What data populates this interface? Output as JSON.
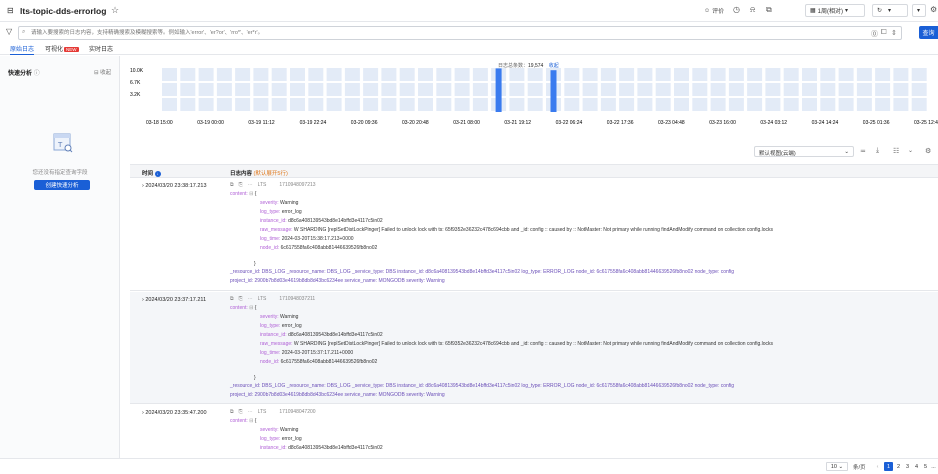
{
  "header": {
    "title": "lts-topic-dds-errorlog",
    "eval_label": "评价",
    "time_range": "1周(相对)",
    "colors": {
      "accent": "#1a5fd6"
    }
  },
  "search": {
    "placeholder": "请输入要搜索的日志内容，支持精确搜索及模糊搜索等。例如输入'error'、'er?or'、'rro*'、'er*r'。",
    "button_label": "查询"
  },
  "tabs": [
    {
      "label": "原始日志",
      "active": true
    },
    {
      "label": "可视化",
      "badge": "NEW"
    },
    {
      "label": "实时日志"
    }
  ],
  "sidebar": {
    "title": "快速分析",
    "fold_label": "收起",
    "empty_text": "您还没有指定查询字段",
    "create_button": "创建快速分析"
  },
  "chart_data": {
    "type": "bar",
    "total_label": "日志总条数：",
    "total_value": "19,574",
    "fold_label": "收起",
    "y_ticks": [
      "10.0K",
      "6.7K",
      "3.2K"
    ],
    "x_labels": [
      "03-18 15:00",
      "03-19 00:00",
      "03-19 11:12",
      "03-19 22:24",
      "03-20 09:36",
      "03-20 20:48",
      "03-21 08:00",
      "03-21 19:12",
      "03-22 06:24",
      "03-22 17:36",
      "03-23 04:48",
      "03-23 16:00",
      "03-24 03:12",
      "03-24 14:24",
      "03-25 01:36",
      "03-25 12:48"
    ],
    "ylim": [
      0,
      10000
    ],
    "bar_count": 42,
    "highlight_bars": [
      {
        "index": 18,
        "value": 9900
      },
      {
        "index": 21,
        "value": 9500
      }
    ],
    "bar_colors": {
      "normal": "#e3ebf7",
      "highlight": "#3a7bef"
    }
  },
  "toolbar": {
    "view_select": "默认视图(云端)"
  },
  "table": {
    "col_time": "时间",
    "col_content": "日志内容",
    "col_content_hint": "(默认展开5行)",
    "rows": [
      {
        "time": "2024/03/20 23:38:17.213",
        "source": "LTS",
        "ts": "1710948097213",
        "content_label": "content:",
        "fields": [
          {
            "k": "severity:",
            "v": "Warning"
          },
          {
            "k": "log_type:",
            "v": "error_log"
          },
          {
            "k": "instance_id:",
            "v": "d8c6a408139543bd8e14bffd3e4117c5in02"
          },
          {
            "k": "raw_message:",
            "v": "W SHARDING [replSetDistLockPinger] Failed to unlock lock with ts: 65f9352e36232c478c694cbb and _id: config :: caused by :: NotMaster: Not primary while running findAndModify command on collection config.locks"
          },
          {
            "k": "log_time:",
            "v": "2024-03-20T15:38:17.213+0000"
          },
          {
            "k": "node_id:",
            "v": "6c617558fa6c408abb81446639526fb8no02"
          }
        ],
        "meta1": "_resource_id: DBS_LOG  _resource_name: DBS_LOG  _service_type: DBS  instance_id: d8c6a408139543bd8e14bffd3e4117c5in02  log_type: ERROR_LOG  node_id: 6c617558fa6c408abb81446639526fb8no02  node_type: config",
        "meta2": "project_id: 2900b7b8d03e4619b8db8d43bc6234ee  service_name: MONGODB  severity: Warning"
      },
      {
        "time": "2024/03/20 23:37:17.211",
        "source": "LTS",
        "ts": "1710948037211",
        "content_label": "content:",
        "fields": [
          {
            "k": "severity:",
            "v": "Warning"
          },
          {
            "k": "log_type:",
            "v": "error_log"
          },
          {
            "k": "instance_id:",
            "v": "d8c6a408139543bd8e14bffd3e4117c5in02"
          },
          {
            "k": "raw_message:",
            "v": "W SHARDING [replSetDistLockPinger] Failed to unlock lock with ts: 65f9352e36232c478c694cbb and _id: config :: caused by :: NotMaster: Not primary while running findAndModify command on collection config.locks"
          },
          {
            "k": "log_time:",
            "v": "2024-03-20T15:37:17.211+0000"
          },
          {
            "k": "node_id:",
            "v": "6c617558fa6c408abb81446639526fb8no02"
          }
        ],
        "meta1": "_resource_id: DBS_LOG  _resource_name: DBS_LOG  _service_type: DBS  instance_id: d8c6a408139543bd8e14bffd3e4117c5in02  log_type: ERROR_LOG  node_id: 6c617558fa6c408abb81446639526fb8no02  node_type: config",
        "meta2": "project_id: 2900b7b8d03e4619b8db8d43bc6234ee  service_name: MONGODB  severity: Warning"
      },
      {
        "time": "2024/03/20 23:35:47.200",
        "source": "LTS",
        "ts": "1710948047200",
        "content_label": "content:",
        "fields": [
          {
            "k": "severity:",
            "v": "Warning"
          },
          {
            "k": "log_type:",
            "v": "error_log"
          },
          {
            "k": "instance_id:",
            "v": "d8c6a408139543bd8e14bffd3e4117c5in02"
          }
        ]
      }
    ]
  },
  "pagination": {
    "page_size": "10",
    "total_label": "条/页",
    "pages": [
      "1",
      "2",
      "3",
      "4",
      "5",
      "..."
    ]
  }
}
